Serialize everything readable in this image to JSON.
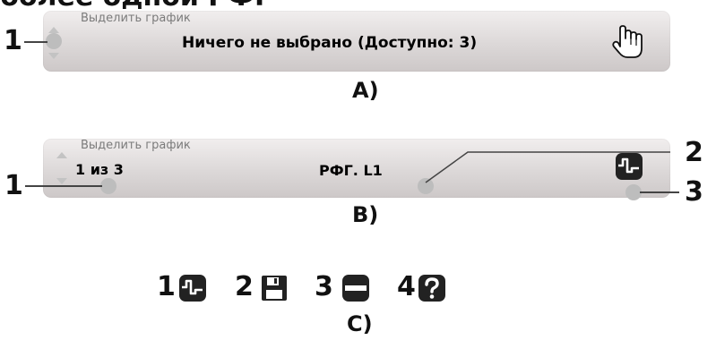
{
  "header": {
    "title": "более одной РФГ"
  },
  "panel_a": {
    "hint": "Выделить график",
    "status": "Ничего не выбрано (Доступно: 3)",
    "callout_1": "1",
    "caption": "A)",
    "icon": "hand-cursor-icon"
  },
  "panel_b": {
    "hint": "Выделить график",
    "counter": "1 из 3",
    "selection": "РФГ. L1",
    "callout_1": "1",
    "callout_2": "2",
    "callout_3": "3",
    "caption": "B)",
    "icon": "waveform-icon"
  },
  "legend": {
    "items": [
      {
        "num": "1",
        "icon": "waveform-icon"
      },
      {
        "num": "2",
        "icon": "save-icon"
      },
      {
        "num": "3",
        "icon": "minus-icon"
      },
      {
        "num": "4",
        "icon": "question-icon"
      }
    ],
    "caption": "C)"
  },
  "colors": {
    "panel_top": "#f1eeee",
    "panel_bottom": "#cdc8c8",
    "hint_text": "#7b7b7b",
    "dot": "#bdbdbd",
    "icon_dark": "#1f1f1f"
  }
}
